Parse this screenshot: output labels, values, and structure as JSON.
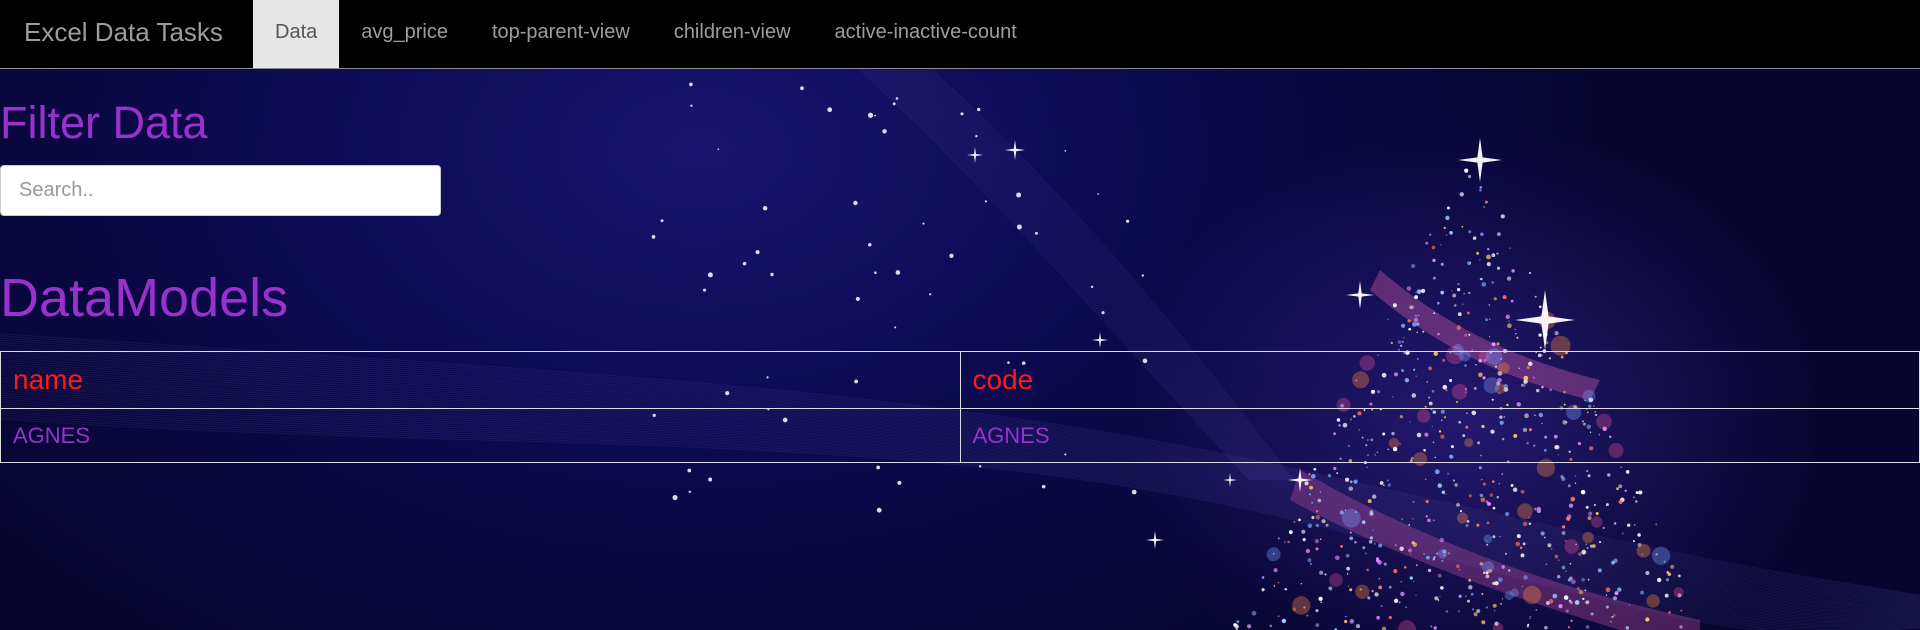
{
  "navbar": {
    "brand": "Excel Data Tasks",
    "items": [
      {
        "label": "Data",
        "active": true
      },
      {
        "label": "avg_price",
        "active": false
      },
      {
        "label": "top-parent-view",
        "active": false
      },
      {
        "label": "children-view",
        "active": false
      },
      {
        "label": "active-inactive-count",
        "active": false
      }
    ]
  },
  "filter": {
    "heading": "Filter Data",
    "placeholder": "Search..",
    "value": ""
  },
  "models": {
    "heading": "DataModels",
    "columns": [
      "name",
      "code"
    ],
    "rows": [
      [
        "AGNES",
        "AGNES"
      ]
    ]
  },
  "colors": {
    "heading": "#9932cc",
    "table_header": "#ff1a1a",
    "navbar_bg": "#000000",
    "active_tab_bg": "#e7e7e7"
  }
}
